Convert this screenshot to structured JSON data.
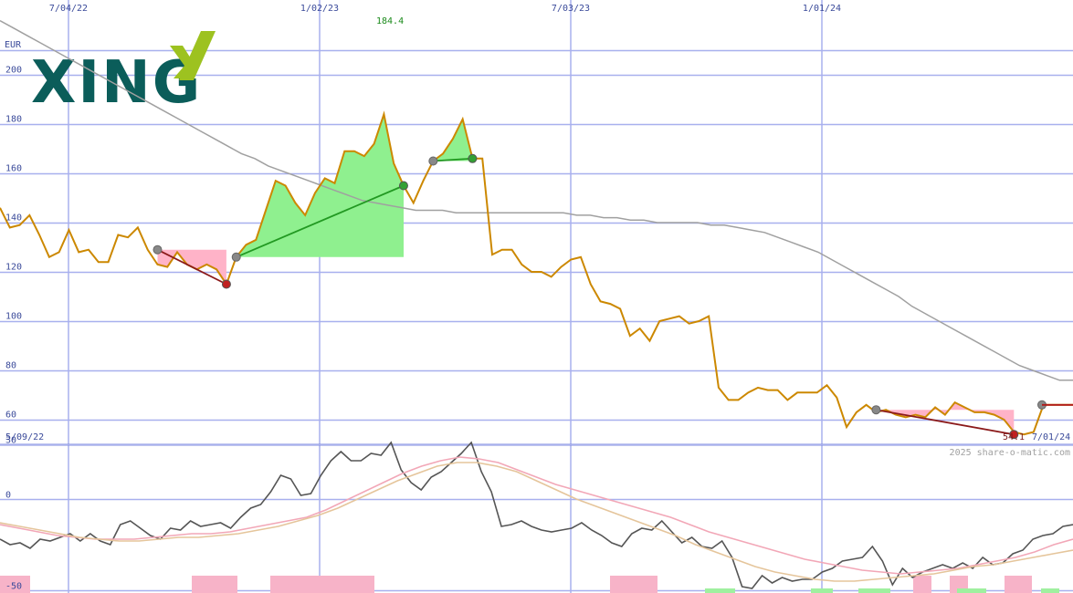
{
  "chart_data": [
    {
      "type": "line",
      "currency_label": "EUR",
      "x_tick_labels": [
        "7/04/22",
        "1/02/23",
        "7/03/23",
        "1/01/24"
      ],
      "y_ticks": [
        60,
        80,
        100,
        120,
        140,
        160,
        180,
        200
      ],
      "ylim": [
        49,
        210
      ],
      "grid": true,
      "start_date_label": "5/09/22",
      "end_date_label": "7/01/24",
      "max_label": "184.4",
      "min_label": "54.1",
      "copyright": "2025 share-o-matic.com",
      "logo_text": "XING",
      "colors": {
        "price": "#cc8800",
        "long_ma": "#a0a0a0",
        "gain_fill": "#8ff08f",
        "loss_fill": "#ffb3c8",
        "gain_line": "#229922",
        "loss_line": "#8b1a1a",
        "grid": "#a8b0ee"
      },
      "series": [
        {
          "key": "price",
          "values": [
            146,
            138,
            139,
            143,
            135,
            126,
            128,
            137,
            128,
            129,
            124,
            124,
            135,
            134,
            138,
            129,
            123,
            122,
            128,
            123,
            121,
            123,
            121,
            115,
            126,
            131,
            133,
            145,
            157,
            155,
            148,
            143,
            152,
            158,
            156,
            169,
            169,
            167,
            172,
            184,
            164,
            155,
            148,
            157,
            165,
            168,
            174,
            182,
            166,
            166,
            127,
            129,
            129,
            123,
            120,
            120,
            118,
            122,
            125,
            126,
            115,
            108,
            107,
            105,
            94,
            97,
            92,
            100,
            101,
            102,
            99,
            100,
            102,
            73,
            68,
            68,
            71,
            73,
            72,
            72,
            68,
            71,
            71,
            71,
            74,
            69,
            57,
            63,
            66,
            63,
            64,
            62,
            61,
            62,
            61,
            65,
            62,
            67,
            65,
            63,
            63,
            62,
            60,
            55,
            54,
            55,
            66,
            66,
            66,
            66
          ]
        },
        {
          "key": "long_ma",
          "values": [
            222,
            219,
            216,
            213,
            210,
            207,
            204,
            201,
            198,
            195,
            192,
            189,
            186,
            183,
            180,
            177,
            174,
            171,
            168,
            166,
            163,
            161,
            159,
            157,
            155,
            153,
            151,
            149,
            148,
            147,
            146,
            145,
            145,
            145,
            144,
            144,
            144,
            144,
            144,
            144,
            144,
            144,
            144,
            143,
            143,
            142,
            142,
            141,
            141,
            140,
            140,
            140,
            140,
            139,
            139,
            138,
            137,
            136,
            134,
            132,
            130,
            128,
            125,
            122,
            119,
            116,
            113,
            110,
            106,
            103,
            100,
            97,
            94,
            91,
            88,
            85,
            82,
            80,
            78,
            76,
            76
          ]
        }
      ],
      "trades": [
        {
          "type": "loss",
          "entry": 129,
          "exit": 115
        },
        {
          "type": "gain",
          "entry": 126,
          "exit": 155
        },
        {
          "type": "gain",
          "entry": 165,
          "exit": 166
        },
        {
          "type": "loss",
          "entry": 64,
          "exit": 54
        }
      ]
    },
    {
      "type": "line",
      "y_tick_labels": [
        "30",
        "0",
        "-50"
      ],
      "ylim": [
        -52,
        35
      ],
      "series": [
        {
          "key": "osc_black",
          "values": [
            -22,
            -25,
            -24,
            -27,
            -22,
            -23,
            -21,
            -19,
            -23,
            -19,
            -23,
            -25,
            -14,
            -12,
            -16,
            -20,
            -22,
            -16,
            -17,
            -12,
            -15,
            -14,
            -13,
            -16,
            -10,
            -5,
            -3,
            4,
            13,
            11,
            2,
            3,
            13,
            21,
            26,
            21,
            21,
            25,
            24,
            31,
            16,
            9,
            5,
            12,
            15,
            20,
            25,
            31,
            15,
            4,
            -15,
            -14,
            -12,
            -15,
            -17,
            -18,
            -17,
            -16,
            -13,
            -17,
            -20,
            -24,
            -26,
            -19,
            -16,
            -17,
            -12,
            -18,
            -24,
            -21,
            -26,
            -27,
            -23,
            -32,
            -48,
            -49,
            -42,
            -46,
            -43,
            -45,
            -44,
            -44,
            -40,
            -38,
            -34,
            -33,
            -32,
            -26,
            -34,
            -47,
            -38,
            -43,
            -40,
            -38,
            -36,
            -38,
            -35,
            -38,
            -32,
            -36,
            -35,
            -30,
            -28,
            -22,
            -20,
            -19,
            -15,
            -14
          ]
        },
        {
          "key": "osc_pink",
          "values": [
            -14,
            -16,
            -18,
            -20,
            -21,
            -22,
            -22,
            -22,
            -21,
            -20,
            -19,
            -19,
            -18,
            -16,
            -14,
            -12,
            -10,
            -6,
            -1,
            4,
            9,
            14,
            18,
            21,
            23,
            22,
            20,
            16,
            12,
            8,
            5,
            2,
            -1,
            -4,
            -7,
            -10,
            -14,
            -18,
            -21,
            -24,
            -27,
            -30,
            -33,
            -35,
            -37,
            -39,
            -40,
            -41,
            -40,
            -39,
            -38,
            -36,
            -34,
            -32,
            -29,
            -25,
            -22
          ]
        },
        {
          "key": "osc_tan",
          "values": [
            -13,
            -15,
            -17,
            -19,
            -21,
            -22,
            -23,
            -23,
            -22,
            -21,
            -21,
            -20,
            -19,
            -17,
            -15,
            -12,
            -9,
            -5,
            0,
            5,
            10,
            14,
            18,
            20,
            20,
            18,
            15,
            10,
            5,
            0,
            -4,
            -8,
            -12,
            -16,
            -20,
            -25,
            -29,
            -33,
            -37,
            -40,
            -42,
            -44,
            -45,
            -45,
            -44,
            -43,
            -42,
            -41,
            -39,
            -37,
            -36,
            -34,
            -32,
            -30,
            -28
          ]
        }
      ],
      "histogram": {
        "pink_segments": [
          [
            0,
            33
          ],
          [
            210,
            260
          ],
          [
            296,
            410
          ],
          [
            668,
            720
          ],
          [
            1000,
            1020
          ],
          [
            1040,
            1060
          ],
          [
            1100,
            1130
          ]
        ],
        "green_segments": [
          [
            772,
            805
          ],
          [
            888,
            912
          ],
          [
            940,
            975
          ],
          [
            1048,
            1080
          ],
          [
            1140,
            1160
          ]
        ]
      }
    }
  ]
}
